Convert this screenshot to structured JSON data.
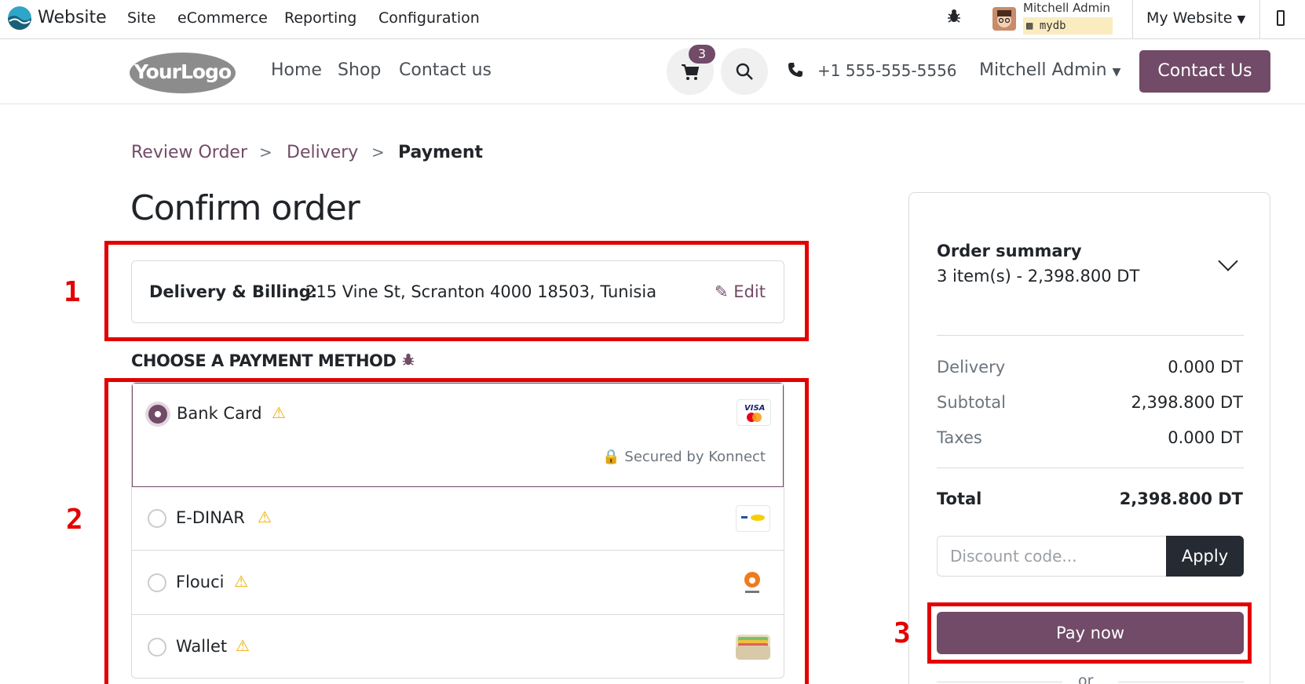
{
  "adminbar": {
    "app_name": "Website",
    "menus": [
      "Site",
      "eCommerce",
      "Reporting",
      "Configuration"
    ],
    "user_name": "Mitchell Admin",
    "db_name": "mydb",
    "website_selector": "My Website",
    "icons": [
      "odoo-logo-icon",
      "bug-icon",
      "user-avatar",
      "caret-down-icon",
      "mobile-icon"
    ]
  },
  "header": {
    "logo_text": "YourLogo",
    "nav": [
      "Home",
      "Shop",
      "Contact us"
    ],
    "cart_count": "3",
    "phone": "+1 555-555-5556",
    "user_menu": "Mitchell Admin",
    "contact_button": "Contact Us"
  },
  "breadcrumb": {
    "steps": [
      "Review Order",
      "Delivery",
      "Payment"
    ],
    "separator": ">"
  },
  "page_title": "Confirm order",
  "address": {
    "label": "Delivery & Billing:",
    "value": "215 Vine St, Scranton 4000 18503, Tunisia",
    "edit_label": "Edit"
  },
  "payment": {
    "heading": "CHOOSE A PAYMENT METHOD",
    "methods": [
      {
        "name": "Bank Card",
        "selected": true,
        "warning": true,
        "logo": "visa-mastercard"
      },
      {
        "name": "E-DINAR",
        "selected": false,
        "warning": true,
        "logo": "edinar-card"
      },
      {
        "name": "Flouci",
        "selected": false,
        "warning": true,
        "logo": "flouci"
      },
      {
        "name": "Wallet",
        "selected": false,
        "warning": true,
        "logo": "wallet"
      }
    ],
    "secured_text": "Secured by Konnect"
  },
  "summary": {
    "title": "Order summary",
    "items_line": "3 item(s) -  2,398.800 DT",
    "rows": [
      {
        "label": "Delivery",
        "value": "0.000 DT"
      },
      {
        "label": "Subtotal",
        "value": "2,398.800 DT"
      },
      {
        "label": "Taxes",
        "value": "0.000 DT"
      }
    ],
    "total_label": "Total",
    "total_value": "2,398.800 DT",
    "discount_placeholder": "Discount code...",
    "apply_label": "Apply",
    "pay_label": "Pay now",
    "or_label": "or"
  },
  "annotations": [
    "1",
    "2",
    "3"
  ],
  "colors": {
    "brand": "#714b67",
    "annotation": "#e30000",
    "warning": "#f0ad00",
    "dark_button": "#262a33"
  }
}
